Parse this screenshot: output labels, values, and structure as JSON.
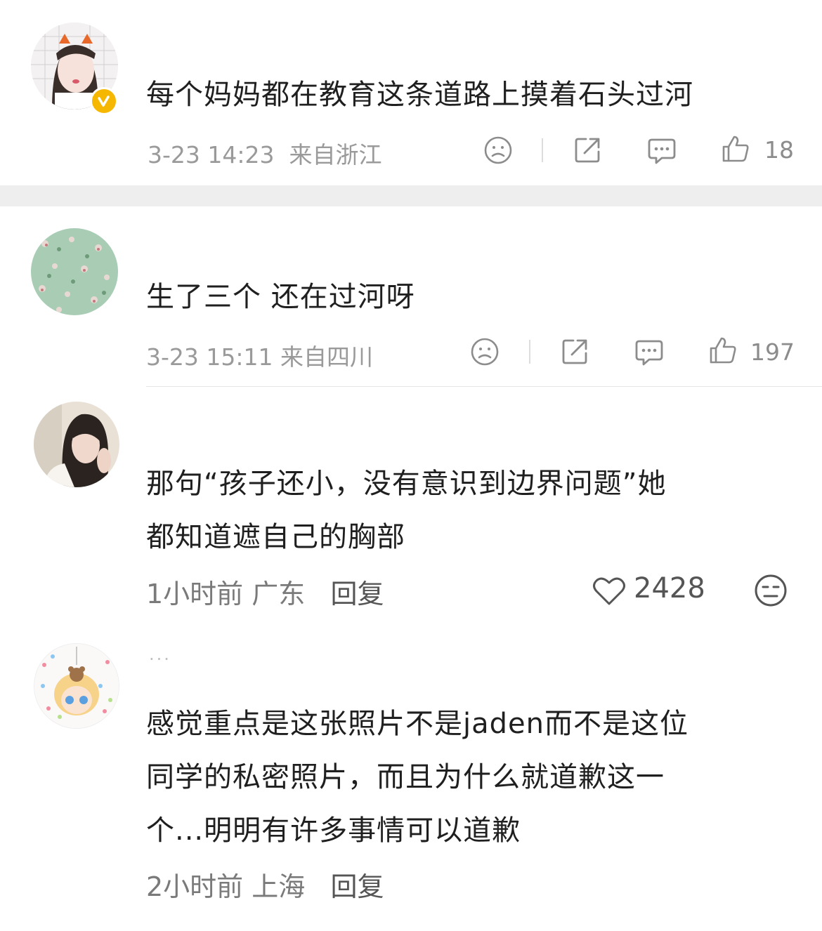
{
  "colors": {
    "badge": "#f5b700",
    "meta_text": "#9a9a9a",
    "body_text": "#1f1f1f",
    "separator_band": "#eeeeee"
  },
  "post": {
    "text": "每个妈妈都在教育这条道路上摸着石头过河",
    "time": "3-23 14:23",
    "location": "来自浙江",
    "like_count": "18",
    "icons": [
      "sad-face-icon",
      "share-icon",
      "comment-icon",
      "thumbs-up-icon"
    ]
  },
  "comment1": {
    "text": "生了三个 还在过河呀",
    "time": "3-23 15:11",
    "location": "来自四川",
    "like_count": "197",
    "icons": [
      "sad-face-icon",
      "share-icon",
      "comment-icon",
      "thumbs-up-icon"
    ]
  },
  "comment2": {
    "text_line1": "那句“孩子还小，没有意识到边界问题”她",
    "text_line2": "都知道遮自己的胸部",
    "time": "1小时前",
    "location": "广东",
    "reply_label": "回复",
    "like_count": "2428",
    "icons": [
      "heart-icon",
      "meh-face-icon"
    ]
  },
  "comment3": {
    "dots": "...",
    "text_line1": "感觉重点是这张照片不是jaden而不是这位",
    "text_line2": "同学的私密照片，而且为什么就道歉这一",
    "text_line3": "个...明明有许多事情可以道歉",
    "time": "2小时前",
    "location": "上海",
    "reply_label": "回复"
  }
}
